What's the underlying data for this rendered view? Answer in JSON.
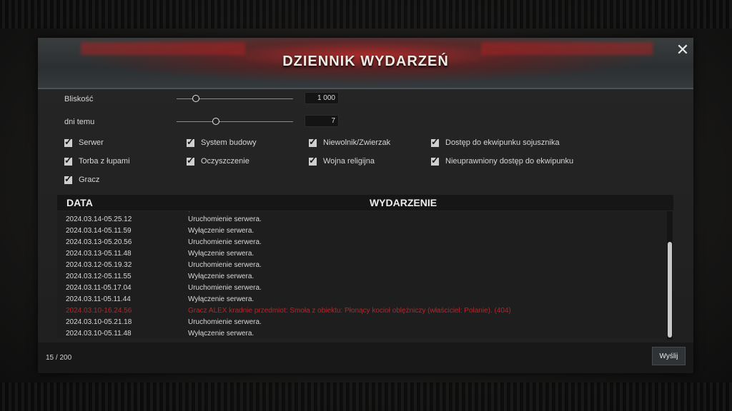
{
  "title": "DZIENNIK WYDARZEŃ",
  "close_glyph": "✕",
  "filters": {
    "proximity": {
      "label": "Bliskość",
      "value": "1 000"
    },
    "days": {
      "label": "dni temu",
      "value": "7"
    }
  },
  "checkboxes": [
    {
      "label": "Serwer",
      "checked": true
    },
    {
      "label": "System budowy",
      "checked": true
    },
    {
      "label": "Niewolnik/Zwierzak",
      "checked": true
    },
    {
      "label": "Dostęp do ekwipunku sojusznika",
      "checked": true
    },
    {
      "label": "Torba z łupami",
      "checked": true
    },
    {
      "label": "Oczyszczenie",
      "checked": true
    },
    {
      "label": "Wojna religijna",
      "checked": true
    },
    {
      "label": "Nieuprawniony dostęp do ekwipunku",
      "checked": true
    },
    {
      "label": "Gracz",
      "checked": true
    }
  ],
  "table": {
    "col_date": "DATA",
    "col_event": "WYDARZENIE",
    "rows": [
      {
        "date": "2024.03.14-05.25.12",
        "event": "Uruchomienie serwera."
      },
      {
        "date": "2024.03.14-05.11.59",
        "event": "Wyłączenie serwera."
      },
      {
        "date": "2024.03.13-05.20.56",
        "event": "Uruchomienie serwera."
      },
      {
        "date": "2024.03.13-05.11.48",
        "event": "Wyłączenie serwera."
      },
      {
        "date": "2024.03.12-05.19.32",
        "event": "Uruchomienie serwera."
      },
      {
        "date": "2024.03.12-05.11.55",
        "event": "Wyłączenie serwera."
      },
      {
        "date": "2024.03.11-05.17.04",
        "event": "Uruchomienie serwera."
      },
      {
        "date": "2024.03.11-05.11.44",
        "event": "Wyłączenie serwera."
      },
      {
        "date": "2024.03.10-16.24.56",
        "event": "Gracz ALEX kradnie przedmiot: Smoła z obiektu: Płonący kocioł oblężniczy (właściciel: Polanie). (404)",
        "highlight": true
      },
      {
        "date": "2024.03.10-05.21.18",
        "event": "Uruchomienie serwera."
      },
      {
        "date": "2024.03.10-05.11.48",
        "event": "Wyłączenie serwera."
      }
    ]
  },
  "footer": {
    "count": "15 / 200",
    "send_label": "Wyślij"
  },
  "colors": {
    "highlight": "#b3262a",
    "accent_red": "#9c2226"
  }
}
